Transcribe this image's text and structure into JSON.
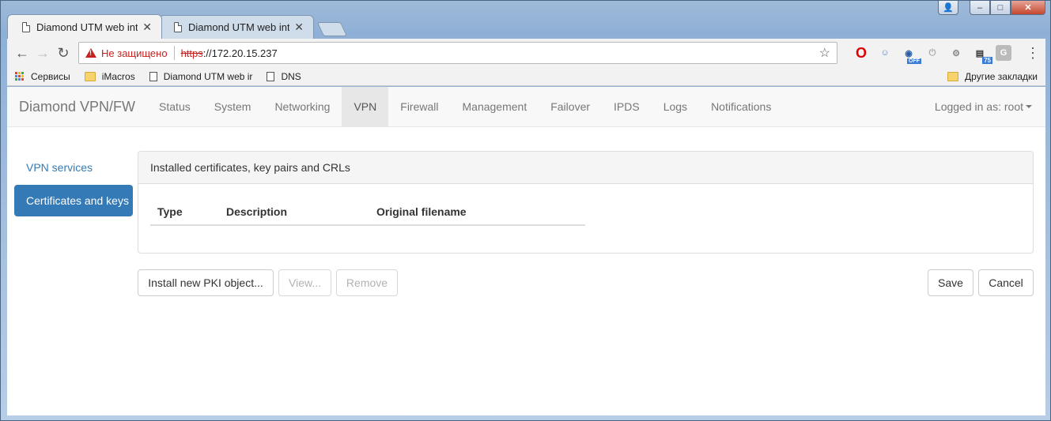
{
  "browser": {
    "tabs": [
      {
        "title": "Diamond UTM web interface",
        "active": true
      },
      {
        "title": "Diamond UTM web interface",
        "active": false
      }
    ],
    "address": {
      "security_label": "Не защищено",
      "scheme": "https",
      "rest": "://172.20.15.237"
    },
    "extensions": [
      {
        "name": "opera-icon",
        "glyph": "O"
      },
      {
        "name": "extension-icon",
        "glyph": "☺"
      },
      {
        "name": "extension-off-icon",
        "glyph": "◉"
      },
      {
        "name": "power-icon",
        "glyph": "⏻"
      },
      {
        "name": "extension-gear-icon",
        "glyph": "⚙"
      },
      {
        "name": "extension-badge-icon",
        "glyph": "▤"
      },
      {
        "name": "extension-g-icon",
        "glyph": "G"
      }
    ],
    "bookmarks": [
      {
        "label": "Сервисы",
        "icon": "apps-icon"
      },
      {
        "label": "iMacros",
        "icon": "folder-icon"
      },
      {
        "label": "Diamond UTM web ir",
        "icon": "page-icon"
      },
      {
        "label": "DNS",
        "icon": "page-icon"
      }
    ],
    "other_bookmarks": "Другие закладки",
    "colors": {
      "insecure": "#c5221f"
    }
  },
  "app": {
    "brand": "Diamond VPN/FW",
    "nav": [
      "Status",
      "System",
      "Networking",
      "VPN",
      "Firewall",
      "Management",
      "Failover",
      "IPDS",
      "Logs",
      "Notifications"
    ],
    "active_nav": "VPN",
    "user": "Logged in as: root",
    "sidebar": [
      {
        "label": "VPN services",
        "active": false
      },
      {
        "label": "Certificates and keys",
        "active": true
      }
    ],
    "panel": {
      "heading": "Installed certificates, key pairs and CRLs",
      "columns": [
        "Type",
        "Description",
        "Original filename"
      ]
    },
    "buttons": {
      "install": "Install new PKI object...",
      "view": "View...",
      "remove": "Remove",
      "save": "Save",
      "cancel": "Cancel"
    },
    "colors": {
      "primary": "#337ab7"
    }
  }
}
